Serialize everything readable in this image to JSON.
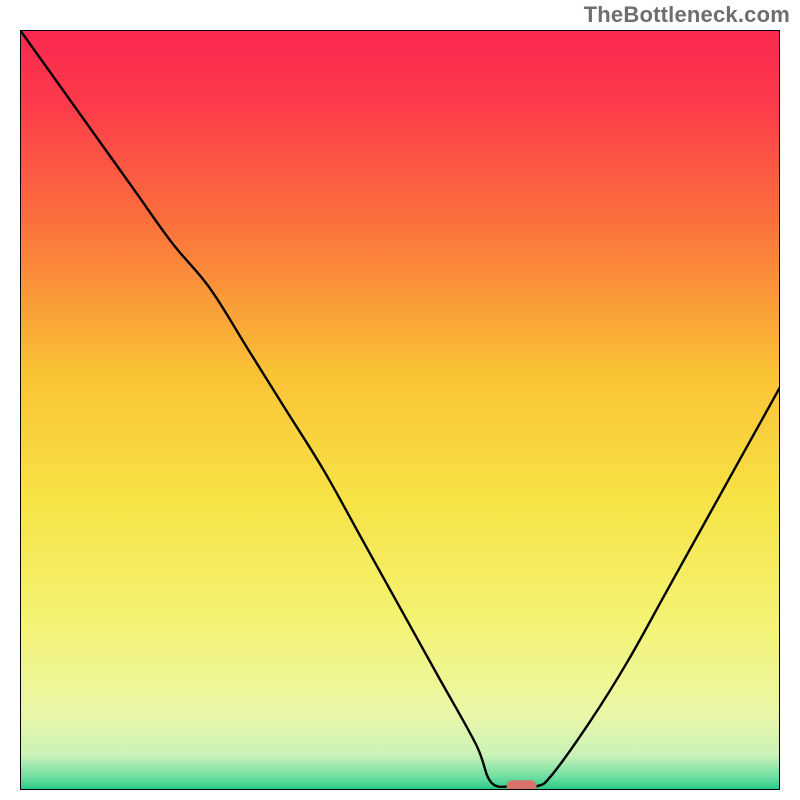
{
  "watermark": {
    "text": "TheBottleneck.com"
  },
  "chart_data": {
    "type": "line",
    "title": "",
    "xlabel": "",
    "ylabel": "",
    "xlim": [
      0,
      100
    ],
    "ylim": [
      0,
      100
    ],
    "grid": false,
    "legend": false,
    "annotations": [],
    "series": [
      {
        "name": "bottleneck-curve",
        "color": "#000000",
        "x": [
          0,
          5,
          10,
          15,
          20,
          25,
          30,
          35,
          40,
          45,
          50,
          55,
          60,
          62,
          65,
          68,
          70,
          75,
          80,
          85,
          90,
          95,
          100
        ],
        "values": [
          100,
          93,
          86,
          79,
          72,
          66,
          58,
          50,
          42,
          33,
          24,
          15,
          6,
          1,
          0.5,
          0.5,
          2,
          9,
          17,
          26,
          35,
          44,
          53
        ]
      }
    ],
    "marker": {
      "name": "optimal-point",
      "x": 66,
      "y": 0.5,
      "color": "#d9736b",
      "shape": "pill"
    },
    "background_gradient": {
      "type": "vertical",
      "stops": [
        {
          "pos": 0.0,
          "color": "#fb2850"
        },
        {
          "pos": 0.1,
          "color": "#fc3c4a"
        },
        {
          "pos": 0.25,
          "color": "#fb6f3c"
        },
        {
          "pos": 0.45,
          "color": "#fac235"
        },
        {
          "pos": 0.62,
          "color": "#f7e346"
        },
        {
          "pos": 0.78,
          "color": "#f4f374"
        },
        {
          "pos": 0.9,
          "color": "#eaf7a8"
        },
        {
          "pos": 0.955,
          "color": "#c9f2b8"
        },
        {
          "pos": 0.985,
          "color": "#66dca0"
        },
        {
          "pos": 1.0,
          "color": "#22c884"
        }
      ]
    }
  }
}
